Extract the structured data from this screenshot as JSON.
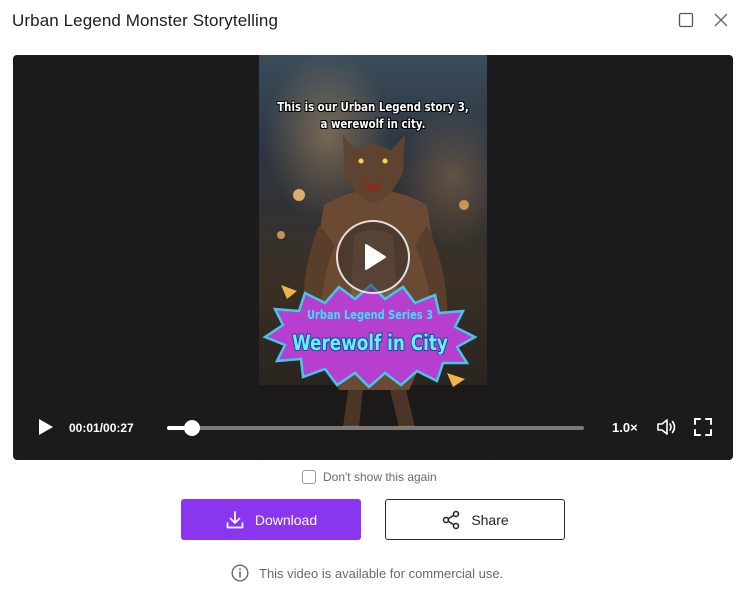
{
  "dialog": {
    "title": "Urban Legend Monster Storytelling",
    "maximize_icon": "maximize-icon",
    "close_icon": "close-icon"
  },
  "video": {
    "caption_line1": "This is our Urban Legend story 3,",
    "caption_line2": "a werewolf in city.",
    "badge_subtitle": "Urban Legend Series 3",
    "badge_title": "Werewolf in City",
    "badge_color": "#b63fd0",
    "badge_text_color": "#5ff3ff"
  },
  "controls": {
    "time": "00:01/00:27",
    "progress": 0.06,
    "speed": "1.0×",
    "play_icon": "play-icon",
    "volume_icon": "volume-icon",
    "fullscreen_icon": "fullscreen-icon"
  },
  "options": {
    "dont_show_label": "Don't show this again",
    "dont_show_checked": false
  },
  "actions": {
    "download_label": "Download",
    "share_label": "Share",
    "download_color": "#8a36ee"
  },
  "footer": {
    "notice": "This video is available for commercial use.",
    "info_icon": "info-icon"
  }
}
